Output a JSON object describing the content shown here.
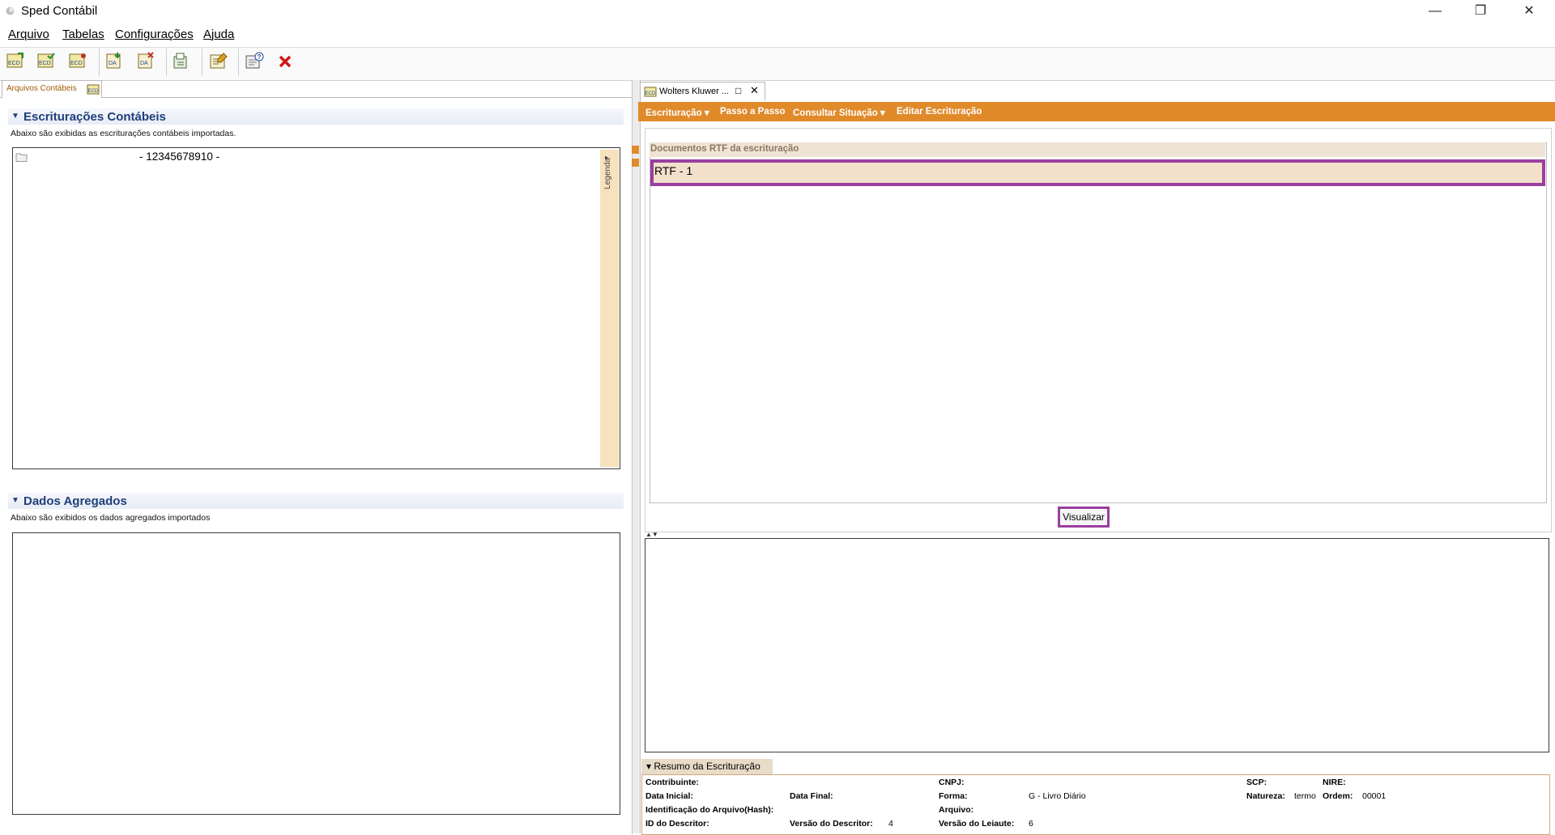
{
  "window": {
    "title": "Sped Contábil",
    "controls": [
      "minimize-icon",
      "restore-icon",
      "close-icon"
    ]
  },
  "menubar": [
    "Arquivo",
    "Tabelas",
    "Configurações",
    "Ajuda"
  ],
  "toolbar": {
    "icons": [
      "ecd-import-icon",
      "ecd-validate-icon",
      "ecd-sign-icon",
      "da-import-icon",
      "da-delete-icon",
      "export-icon",
      "edit-icon",
      "help-icon",
      "delete-icon"
    ]
  },
  "left_panel": {
    "tab_label": "Arquivos Contábeis",
    "escrituracoes": {
      "title": "Escriturações Contábeis",
      "description": "Abaixo são exibidas as escriturações contábeis importadas.",
      "items": [
        {
          "label": "- 12345678910 -"
        }
      ],
      "legend_label": "Legenda"
    },
    "dados_agregados": {
      "title": "Dados Agregados",
      "description": "Abaixo são exibidos os dados agregados importados"
    }
  },
  "right_panel": {
    "tab_label": "Wolters Kluwer ...",
    "menu": [
      "Escrituração ▾",
      "Passo a Passo",
      "Consultar Situação ▾",
      "Editar Escrituração"
    ],
    "documents_header": "Documentos RTF da escrituração",
    "documents": [
      {
        "label": "RTF - 1"
      }
    ],
    "visualizar_button": "Visualizar"
  },
  "resumo": {
    "tab_label": "▾ Resumo da Escrituração",
    "labels": {
      "contribuinte": "Contribuinte:",
      "data_inicial": "Data Inicial:",
      "identificacao": "Identificação do Arquivo(Hash):",
      "id_descritor": "ID do Descritor:",
      "data_final": "Data Final:",
      "versao_descritor": "Versão do Descritor:",
      "cnpj": "CNPJ:",
      "forma": "Forma:",
      "arquivo": "Arquivo:",
      "versao_leiaute": "Versão do Leiaute:",
      "scp": "SCP:",
      "natureza": "Natureza:",
      "nire": "NIRE:",
      "ordem": "Ordem:"
    },
    "values": {
      "versao_descritor": "4",
      "forma": "G - Livro Diário",
      "versao_leiaute": "6",
      "natureza": "termo",
      "ordem": "00001"
    }
  },
  "colors": {
    "accent_orange": "#e08a2a",
    "highlight_purple": "#9a3ea0",
    "section_blue": "#1f3f7a"
  }
}
